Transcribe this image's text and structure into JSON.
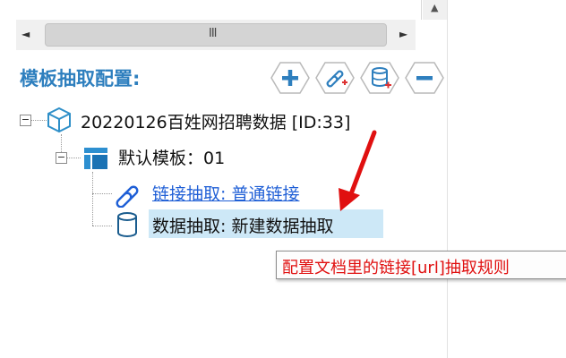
{
  "scrollbar": {
    "grip": "III",
    "left_arrow": "◄",
    "right_arrow": "►",
    "up_arrow": "▲"
  },
  "config": {
    "title": "模板抽取配置:"
  },
  "toolbar": {
    "buttons": [
      {
        "name": "add",
        "icon": "plus-icon"
      },
      {
        "name": "link-extract",
        "icon": "link-add-icon"
      },
      {
        "name": "data-extract",
        "icon": "database-add-icon"
      },
      {
        "name": "remove",
        "icon": "minus-icon"
      }
    ]
  },
  "tree": {
    "root_label": "20220126百姓网招聘数据 [ID:33]",
    "template_label": "默认模板：01",
    "link_node_label": "链接抽取: 普通链接",
    "data_node_label": "数据抽取: 新建数据抽取"
  },
  "tooltip": {
    "text": "配置文档里的链接[url]抽取规则"
  },
  "colors": {
    "accent": "#2e7fbe",
    "link": "#1f5fd6",
    "selection": "#cde8f7",
    "tooltip_text": "#e01010",
    "annotation_arrow": "#e01010"
  }
}
